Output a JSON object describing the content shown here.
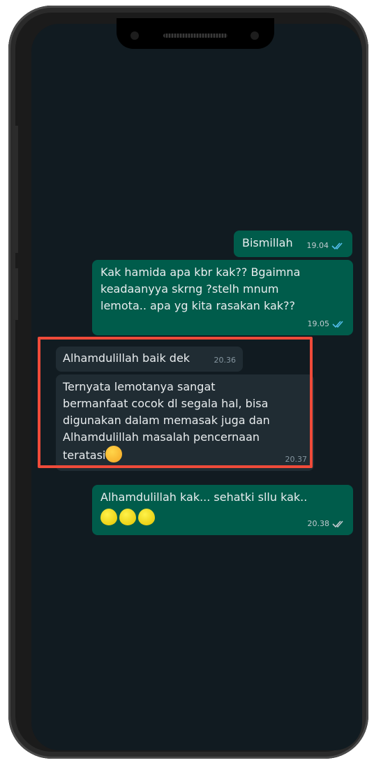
{
  "messages": [
    {
      "id": "m1",
      "direction": "out",
      "text": "Bismillah",
      "time": "19.04",
      "status": "read"
    },
    {
      "id": "m2",
      "direction": "out",
      "text": "Kak hamida apa kbr kak?? Bgaimna\nkeadaanyya skrng ?stelh mnum\nlemota.. apa yg kita rasakan kak??",
      "time": "19.05",
      "status": "read"
    },
    {
      "id": "m3",
      "direction": "in",
      "text": "Alhamdulillah baik dek",
      "time": "20.36"
    },
    {
      "id": "m4",
      "direction": "in",
      "text": "Ternyata lemotanya sangat\nbermanfaat cocok dl segala hal, bisa\ndigunakan dalam memasak juga dan\nAlhamdulillah masalah pencernaan\nteratasi",
      "emoji": "face-with-hand-over-mouth",
      "time": "20.37"
    },
    {
      "id": "m5",
      "direction": "out",
      "text": "Alhamdulillah kak... sehatki  sllu kak..",
      "emoji": "lemon x3",
      "time": "20.38",
      "status": "delivered"
    }
  ],
  "highlight": {
    "color": "#ef4b3a"
  },
  "colors": {
    "background": "#111b21",
    "outgoing_bubble": "#005c4b",
    "incoming_bubble": "#202c33",
    "read_ticks": "#53bdeb",
    "delivered_ticks": "#c2cbd0"
  }
}
